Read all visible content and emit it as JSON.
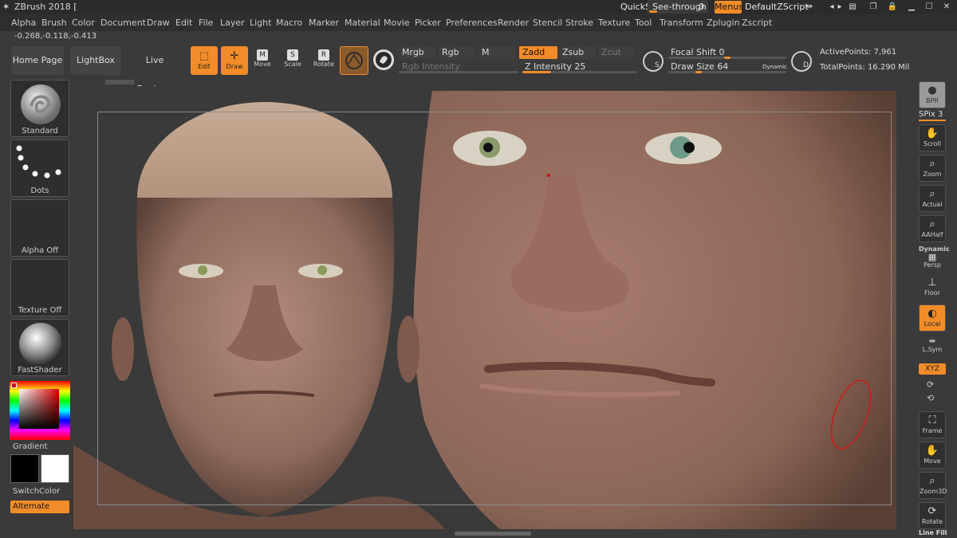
{
  "titlebar": {
    "title": "ZBrush 2018 [",
    "quicksave": "QuickSave",
    "see_through_label": "See-through",
    "see_through_value": "0",
    "menus": "Menus",
    "default_zscript": "DefaultZScript"
  },
  "menubar": {
    "items": [
      "Alpha",
      "Brush",
      "Color",
      "Document",
      "Draw",
      "Edit",
      "File",
      "Layer",
      "Light",
      "Macro",
      "Marker",
      "Material",
      "Movie",
      "Picker",
      "Preferences",
      "Render",
      "Stencil",
      "Stroke",
      "Texture",
      "Tool",
      "Transform",
      "Zplugin",
      "Zscript"
    ]
  },
  "coords": "-0.268,-0.118,-0.413",
  "toolshelf": {
    "home_page": "Home Page",
    "lightbox": "LightBox",
    "live_boolean": "Live Boolean",
    "edit": "Edit",
    "draw": "Draw",
    "move": "Move",
    "scale": "Scale",
    "rotate": "Rotate",
    "mrgb": "Mrgb",
    "rgb": "Rgb",
    "m": "M",
    "rgb_intensity": "Rgb Intensity",
    "zadd": "Zadd",
    "zsub": "Zsub",
    "zcut": "Zcut",
    "z_intensity_label": "Z Intensity",
    "z_intensity_value": "25",
    "z_intensity_level": 0.25,
    "focal_shift_label": "Focal Shift",
    "focal_shift_value": "0",
    "draw_size_label": "Draw Size",
    "draw_size_value": "64",
    "dynamic": "Dynamic",
    "active_points": "ActivePoints: 7,961",
    "total_points": "TotalPoints: 16.290 Mil"
  },
  "leftshelf": {
    "brush": "Standard",
    "stroke": "Dots",
    "alpha": "Alpha Off",
    "texture": "Texture Off",
    "material": "FastShader",
    "gradient": "Gradient",
    "switch_color": "SwitchColor",
    "alternate": "Alternate"
  },
  "rightshelf": {
    "bpr": "BPR",
    "spix_label": "SPix",
    "spix_value": "3",
    "scroll": "Scroll",
    "zoom": "Zoom",
    "actual": "Actual",
    "aahalf": "AAHalf",
    "dynamic": "Dynamic",
    "persp": "Persp",
    "floor": "Floor",
    "local": "Local",
    "lsym": "L.Sym",
    "xyz": "XYZ",
    "frame": "Frame",
    "move": "Move",
    "zoom3d": "Zoom3D",
    "rotate": "Rotate",
    "line_fill": "Line Fill"
  },
  "colors": {
    "accent": "#f28c28",
    "panel": "#3a3a3a",
    "skin": "#9a7566",
    "alert_ellipse": "#d01818"
  }
}
